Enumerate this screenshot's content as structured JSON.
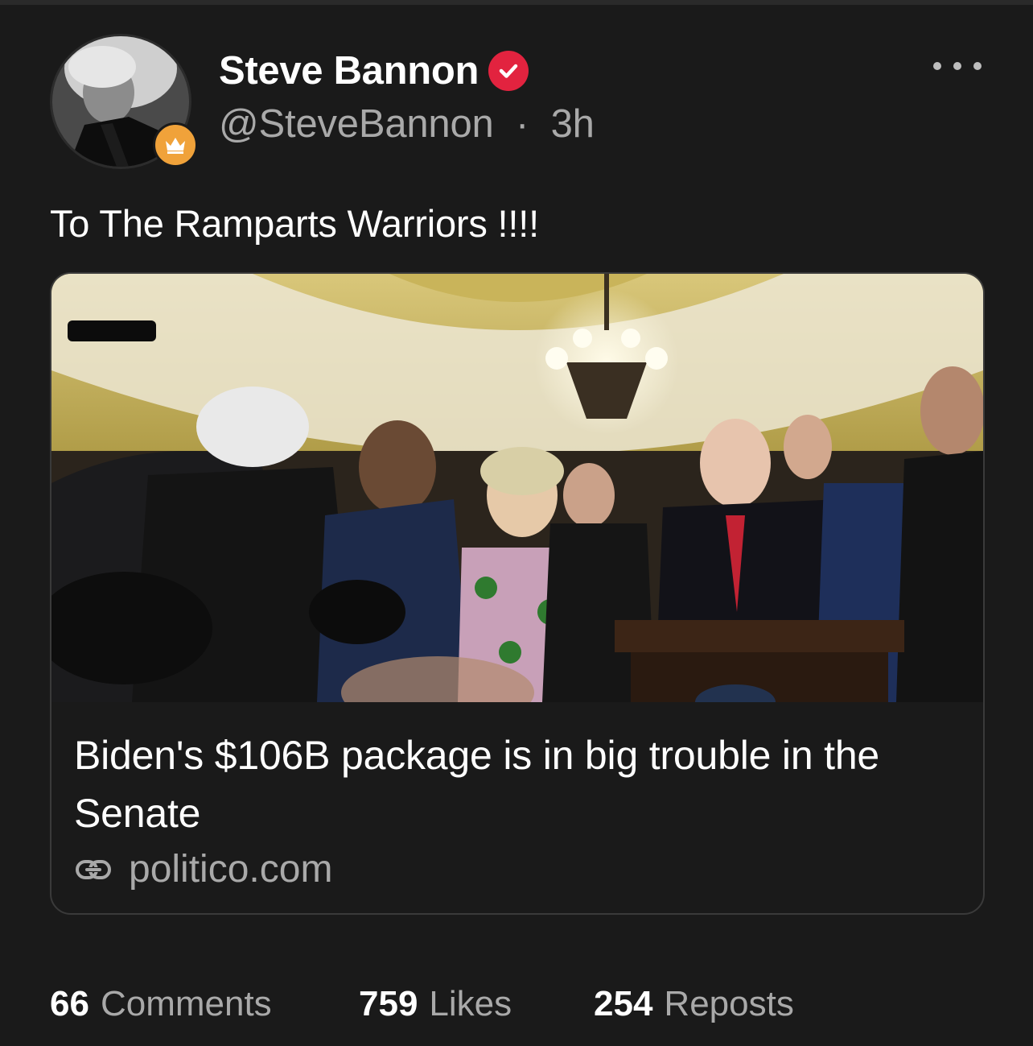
{
  "author": {
    "name": "Steve Bannon",
    "handle": "@SteveBannon",
    "separator": "·",
    "time": "3h"
  },
  "post": {
    "text": "To The Ramparts Warriors !!!!"
  },
  "link_card": {
    "title": "Biden's $106B package is in big trouble in the Senate",
    "domain": "politico.com",
    "image_alt": "Press conference in a Capitol hallway with reporters and cameras"
  },
  "stats": {
    "comments": {
      "count": "66",
      "label": "Comments"
    },
    "likes": {
      "count": "759",
      "label": "Likes"
    },
    "reposts": {
      "count": "254",
      "label": "Reposts"
    }
  },
  "colors": {
    "background": "#1a1a1a",
    "verified": "#e2233f",
    "badge": "#f0a23a",
    "secondary_text": "#a9a9a9"
  },
  "icons": {
    "verified": "checkmark-badge-icon",
    "badge": "crown-icon",
    "more": "more-options-icon",
    "link": "link-icon"
  }
}
